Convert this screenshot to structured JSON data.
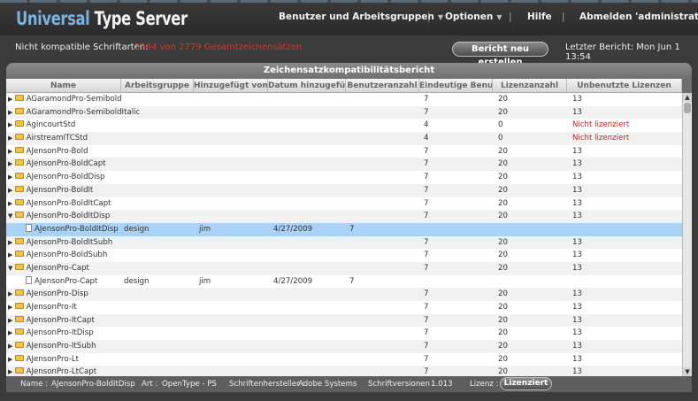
{
  "app": {
    "logo_part1": "Universal",
    "logo_part2": " Type Server"
  },
  "nav": {
    "users": "Benutzer und Arbeitsgruppen",
    "options": "Optionen",
    "help": "Hilfe",
    "logout": "Abmelden 'administrator'",
    "sep": "|"
  },
  "info": {
    "label": "Nicht kompatible Schriftarten:",
    "count_text": "2584 von 2779 Gesamtzeichensätzen",
    "regen_button": "Bericht neu erstellen",
    "last_report": "Letzter Bericht: Mon Jun 1 13:54"
  },
  "panel": {
    "title": "Zeichensatzkompatibilitätsbericht"
  },
  "columns": [
    "Name",
    "Arbeitsgruppe",
    "Hinzugefügt von",
    "Datum hinzugefügt",
    "Benutzeranzahl",
    "Eindeutige Benut...",
    "Lizenzanzahl",
    "Unbenutzte Lizenzen"
  ],
  "rows": [
    {
      "type": "folder",
      "expanded": false,
      "name": "AGaramondPro-Semibold",
      "group": "",
      "by": "",
      "date": "",
      "users": "",
      "unique": "7",
      "lic": "20",
      "unused": "13",
      "warn": false
    },
    {
      "type": "folder",
      "expanded": false,
      "name": "AGaramondPro-SemiboldItalic",
      "group": "",
      "by": "",
      "date": "",
      "users": "",
      "unique": "7",
      "lic": "20",
      "unused": "13",
      "warn": false
    },
    {
      "type": "folder",
      "expanded": false,
      "name": "AgincourtStd",
      "group": "",
      "by": "",
      "date": "",
      "users": "",
      "unique": "4",
      "lic": "0",
      "unused": "Nicht lizenziert",
      "warn": true
    },
    {
      "type": "folder",
      "expanded": false,
      "name": "AirstreamITCStd",
      "group": "",
      "by": "",
      "date": "",
      "users": "",
      "unique": "4",
      "lic": "0",
      "unused": "Nicht lizenziert",
      "warn": true
    },
    {
      "type": "folder",
      "expanded": false,
      "name": "AJensonPro-Bold",
      "group": "",
      "by": "",
      "date": "",
      "users": "",
      "unique": "7",
      "lic": "20",
      "unused": "13",
      "warn": false
    },
    {
      "type": "folder",
      "expanded": false,
      "name": "AJensonPro-BoldCapt",
      "group": "",
      "by": "",
      "date": "",
      "users": "",
      "unique": "7",
      "lic": "20",
      "unused": "13",
      "warn": false
    },
    {
      "type": "folder",
      "expanded": false,
      "name": "AJensonPro-BoldDisp",
      "group": "",
      "by": "",
      "date": "",
      "users": "",
      "unique": "7",
      "lic": "20",
      "unused": "13",
      "warn": false
    },
    {
      "type": "folder",
      "expanded": false,
      "name": "AJensonPro-BoldIt",
      "group": "",
      "by": "",
      "date": "",
      "users": "",
      "unique": "7",
      "lic": "20",
      "unused": "13",
      "warn": false
    },
    {
      "type": "folder",
      "expanded": false,
      "name": "AJensonPro-BoldItCapt",
      "group": "",
      "by": "",
      "date": "",
      "users": "",
      "unique": "7",
      "lic": "20",
      "unused": "13",
      "warn": false
    },
    {
      "type": "folder",
      "expanded": true,
      "name": "AJensonPro-BoldItDisp",
      "group": "",
      "by": "",
      "date": "",
      "users": "",
      "unique": "7",
      "lic": "20",
      "unused": "13",
      "warn": false
    },
    {
      "type": "file",
      "selected": true,
      "name": "AJensonPro-BoldItDisp",
      "group": "design",
      "by": "jim",
      "date": "4/27/2009",
      "users": "7",
      "unique": "",
      "lic": "",
      "unused": "",
      "warn": false
    },
    {
      "type": "folder",
      "expanded": false,
      "name": "AJensonPro-BoldItSubh",
      "group": "",
      "by": "",
      "date": "",
      "users": "",
      "unique": "7",
      "lic": "20",
      "unused": "13",
      "warn": false
    },
    {
      "type": "folder",
      "expanded": false,
      "name": "AJensonPro-BoldSubh",
      "group": "",
      "by": "",
      "date": "",
      "users": "",
      "unique": "7",
      "lic": "20",
      "unused": "13",
      "warn": false
    },
    {
      "type": "folder",
      "expanded": true,
      "name": "AJensonPro-Capt",
      "group": "",
      "by": "",
      "date": "",
      "users": "",
      "unique": "7",
      "lic": "20",
      "unused": "13",
      "warn": false
    },
    {
      "type": "file",
      "selected": false,
      "name": "AJensonPro-Capt",
      "group": "design",
      "by": "jim",
      "date": "4/27/2009",
      "users": "7",
      "unique": "",
      "lic": "",
      "unused": "",
      "warn": false
    },
    {
      "type": "folder",
      "expanded": false,
      "name": "AJensonPro-Disp",
      "group": "",
      "by": "",
      "date": "",
      "users": "",
      "unique": "7",
      "lic": "20",
      "unused": "13",
      "warn": false
    },
    {
      "type": "folder",
      "expanded": false,
      "name": "AJensonPro-It",
      "group": "",
      "by": "",
      "date": "",
      "users": "",
      "unique": "7",
      "lic": "20",
      "unused": "13",
      "warn": false
    },
    {
      "type": "folder",
      "expanded": false,
      "name": "AJensonPro-ItCapt",
      "group": "",
      "by": "",
      "date": "",
      "users": "",
      "unique": "7",
      "lic": "20",
      "unused": "13",
      "warn": false
    },
    {
      "type": "folder",
      "expanded": false,
      "name": "AJensonPro-ItDisp",
      "group": "",
      "by": "",
      "date": "",
      "users": "",
      "unique": "7",
      "lic": "20",
      "unused": "13",
      "warn": false
    },
    {
      "type": "folder",
      "expanded": false,
      "name": "AJensonPro-ItSubh",
      "group": "",
      "by": "",
      "date": "",
      "users": "",
      "unique": "7",
      "lic": "20",
      "unused": "13",
      "warn": false
    },
    {
      "type": "folder",
      "expanded": false,
      "name": "AJensonPro-Lt",
      "group": "",
      "by": "",
      "date": "",
      "users": "",
      "unique": "7",
      "lic": "20",
      "unused": "13",
      "warn": false
    },
    {
      "type": "folder",
      "expanded": false,
      "name": "AJensonPro-LtCapt",
      "group": "",
      "by": "",
      "date": "",
      "users": "",
      "unique": "7",
      "lic": "20",
      "unused": "13",
      "warn": false
    }
  ],
  "footer": {
    "name_label": "Name :",
    "name_value": "AJensonPro-BoldItDisp",
    "type_label": "Art :",
    "type_value": "OpenType - PS",
    "maker_label": "Schriftenhersteller :",
    "maker_value": "Adobe Systems",
    "version_label": "Schriftversionen :",
    "version_value": "1.013",
    "license_label": "Lizenz :",
    "license_button": "Lizenziert"
  },
  "colors": {
    "accent": "#7ab2e0",
    "warning": "#cc2020",
    "selection": "#a9d2f5"
  }
}
